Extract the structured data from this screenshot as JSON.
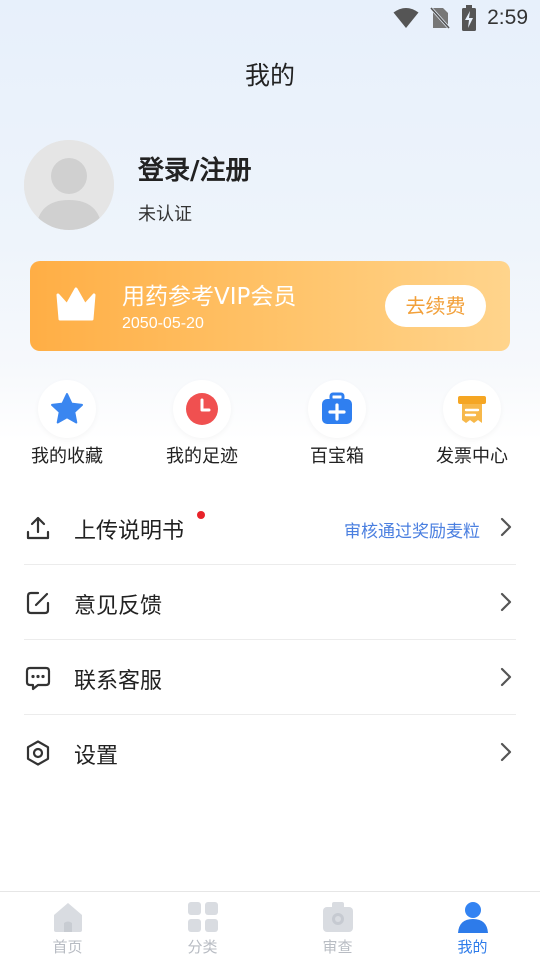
{
  "status_bar": {
    "time": "2:59",
    "icons": [
      "wifi-icon",
      "no-sim-icon",
      "battery-charging-icon"
    ]
  },
  "page": {
    "title": "我的"
  },
  "profile": {
    "login_label": "登录/注册",
    "auth_status": "未认证",
    "avatar_icon": "default-avatar-icon"
  },
  "vip": {
    "title": "用药参考VIP会员",
    "expiry": "2050-05-20",
    "renew_label": "去续费",
    "icon": "crown-icon"
  },
  "quick_actions": [
    {
      "label": "我的收藏",
      "icon": "star-icon",
      "color": "#3a86f0"
    },
    {
      "label": "我的足迹",
      "icon": "clock-icon",
      "color": "#f05050"
    },
    {
      "label": "百宝箱",
      "icon": "toolbox-plus-icon",
      "color": "#2f7ff0"
    },
    {
      "label": "发票中心",
      "icon": "invoice-icon",
      "color": "#f5a623"
    }
  ],
  "menu": [
    {
      "label": "上传说明书",
      "icon": "upload-icon",
      "extra": "审核通过奖励麦粒",
      "has_dot": true
    },
    {
      "label": "意见反馈",
      "icon": "feedback-edit-icon",
      "extra": "",
      "has_dot": false
    },
    {
      "label": "联系客服",
      "icon": "chat-bubble-icon",
      "extra": "",
      "has_dot": false
    },
    {
      "label": "设置",
      "icon": "settings-hexagon-icon",
      "extra": "",
      "has_dot": false
    }
  ],
  "tab_bar": [
    {
      "label": "首页",
      "icon": "home-icon",
      "active": false
    },
    {
      "label": "分类",
      "icon": "grid-icon",
      "active": false
    },
    {
      "label": "审查",
      "icon": "review-icon",
      "active": false
    },
    {
      "label": "我的",
      "icon": "user-icon",
      "active": true
    }
  ],
  "colors": {
    "accent": "#2d7bea",
    "vip_gradient_start": "#ffae45",
    "vip_gradient_end": "#ffd48c",
    "badge_dot": "#e8232a",
    "link_blue": "#4a7fe0"
  }
}
